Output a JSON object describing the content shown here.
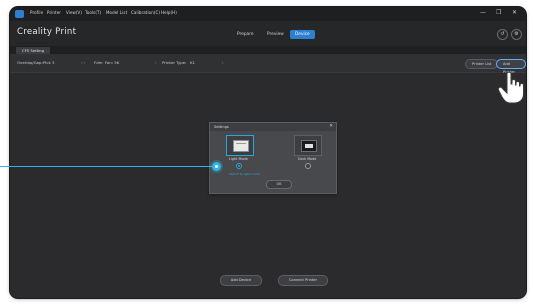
{
  "menubar": {
    "items": [
      "Profile",
      "Printer",
      "View(V)",
      "Tools(T)",
      "Model List",
      "Calibration(C)",
      "Help(H)"
    ],
    "window_controls": [
      "—",
      "❐",
      "✕"
    ]
  },
  "titlebar": {
    "app_title": "Creality Print",
    "modes": [
      "Prepare",
      "Preview",
      "Device"
    ],
    "active_mode": "Device",
    "right_buttons": [
      "↺",
      "⚙"
    ]
  },
  "tab": {
    "label": "CFS Setting"
  },
  "toolbar": {
    "fields": [
      {
        "label": "Overlap/Gap:",
        "value": "Pick 3"
      },
      {
        "label": "Fdm",
        "value": "Fan: 5K"
      },
      {
        "label": "Printer Type:",
        "value": "K1"
      }
    ],
    "buttons": [
      "Printer List",
      "Add Printer"
    ]
  },
  "dialog": {
    "title": "Settings",
    "close": "✕",
    "options": [
      {
        "label": "Light Mode",
        "selected": true
      },
      {
        "label": "Dark Mode",
        "selected": false
      }
    ],
    "link": "Switch to light mode",
    "ok": "OK"
  },
  "bottom_buttons": [
    "Add Device",
    "Connect Printer"
  ],
  "colors": {
    "accent": "#2fa6d8",
    "selected_tab": "#2f7fd1",
    "callout": "#2fb5e8",
    "frame_bg": "#2b2b2d"
  },
  "icons": {
    "hand": "hand-pointer-icon",
    "close": "close-icon",
    "refresh": "refresh-icon",
    "settings": "gear-icon",
    "logo": "app-logo-icon"
  }
}
